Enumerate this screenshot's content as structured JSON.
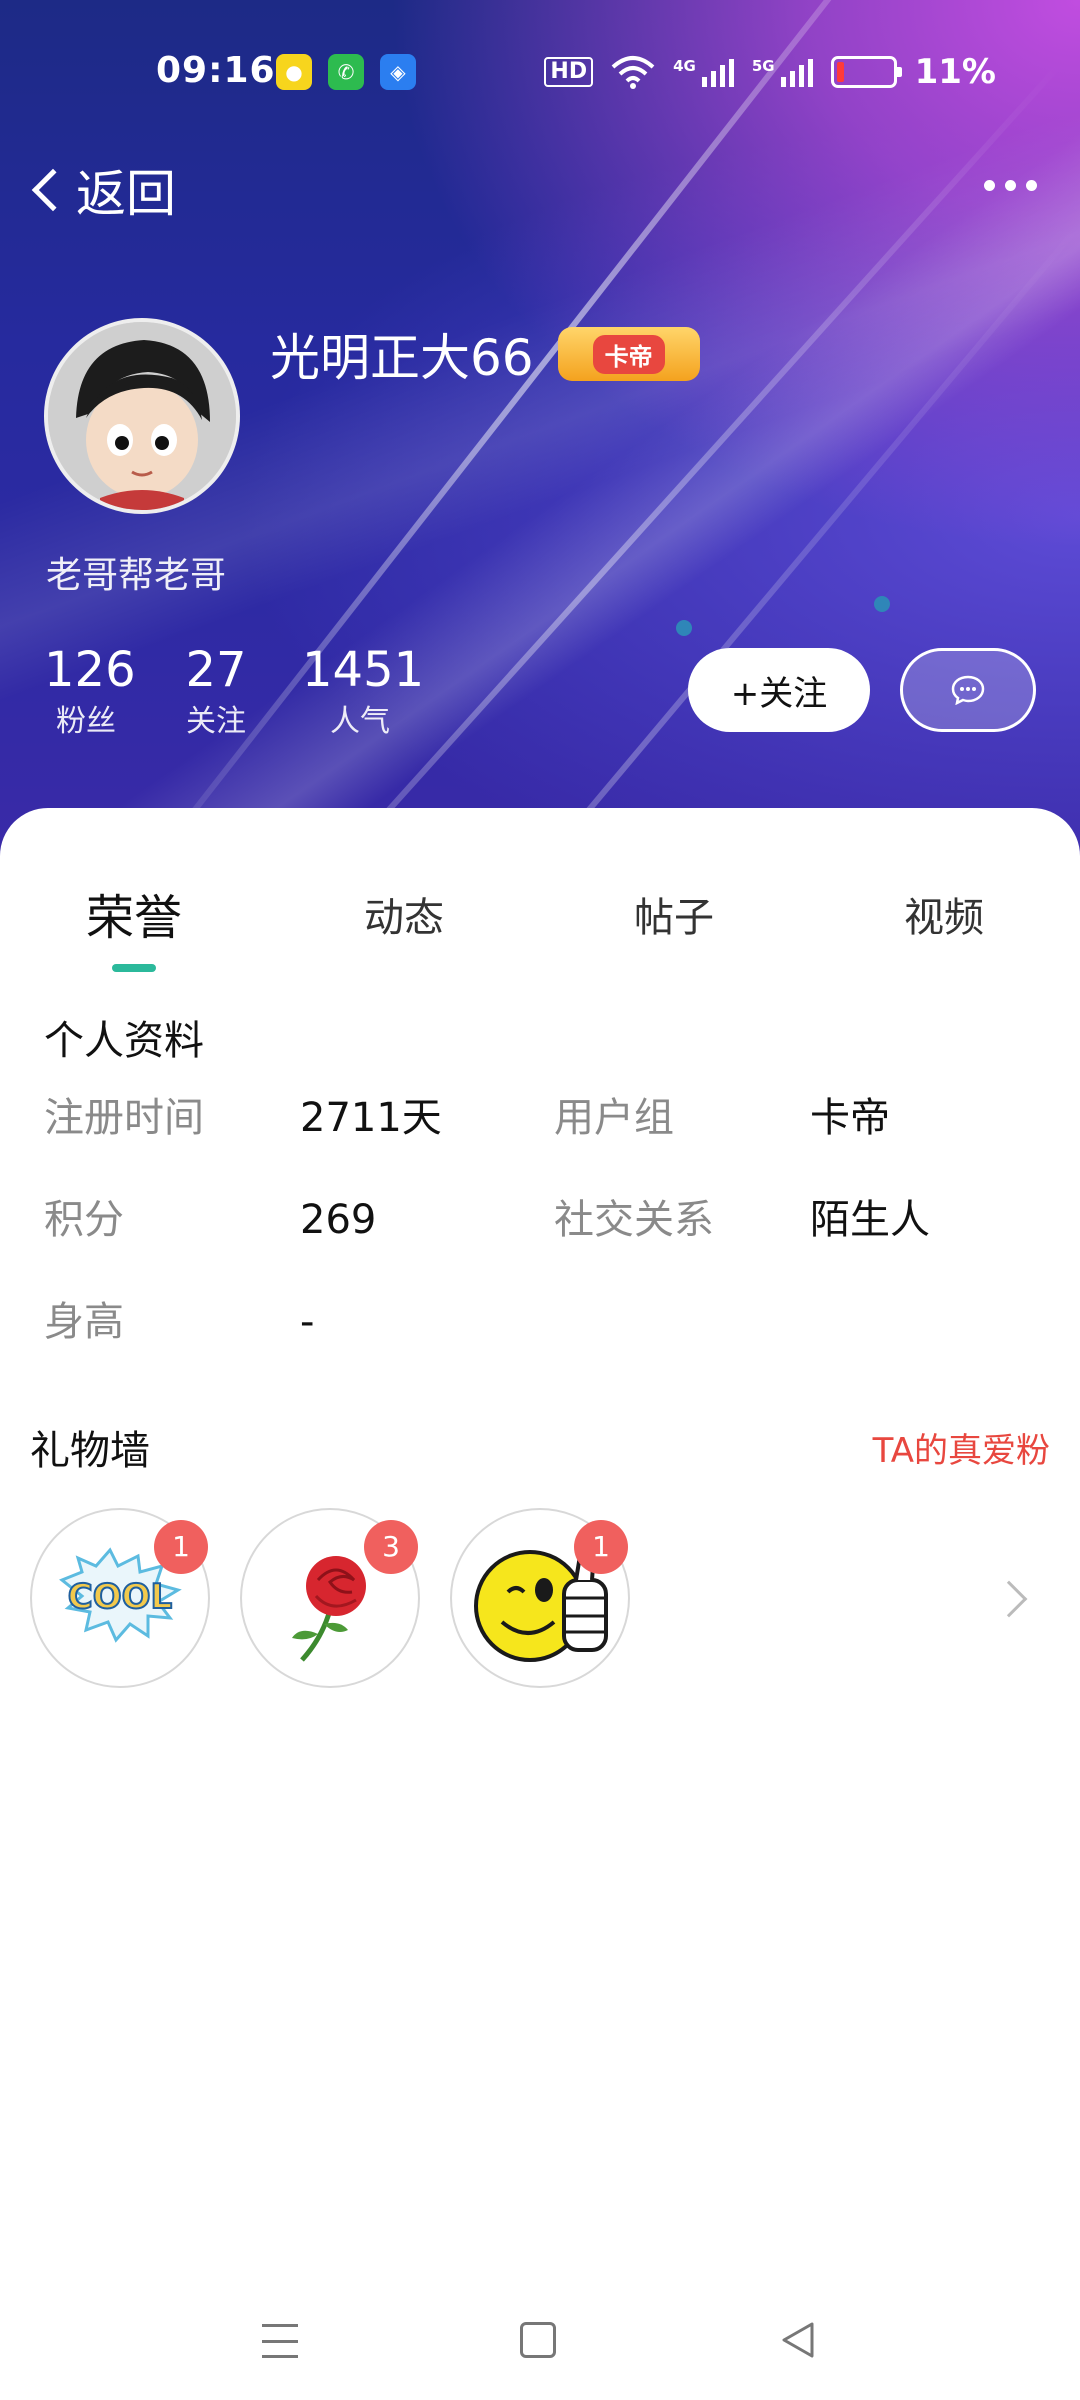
{
  "status_bar": {
    "time": "09:16",
    "hd_label": "HD",
    "net1": "4G",
    "net2": "5G",
    "battery": "11%"
  },
  "nav": {
    "back_label": "返回"
  },
  "profile": {
    "username": "光明正大66",
    "badge": "卡帝",
    "signature": "老哥帮老哥",
    "stats": [
      {
        "value": "126",
        "label": "粉丝"
      },
      {
        "value": "27",
        "label": "关注"
      },
      {
        "value": "1451",
        "label": "人气"
      }
    ],
    "follow_label": "+关注"
  },
  "tabs": [
    "荣誉",
    "动态",
    "帖子",
    "视频"
  ],
  "personal_info": {
    "title": "个人资料",
    "rows": [
      {
        "k1": "注册时间",
        "v1": "2711天",
        "k2": "用户组",
        "v2": "卡帝"
      },
      {
        "k1": "积分",
        "v1": "269",
        "k2": "社交关系",
        "v2": "陌生人"
      },
      {
        "k1": "身高",
        "v1": "-"
      }
    ]
  },
  "gift_wall": {
    "title": "礼物墙",
    "link": "TA的真爱粉",
    "gifts": [
      {
        "name": "cool-sticker",
        "count": "1"
      },
      {
        "name": "rose",
        "count": "3"
      },
      {
        "name": "thumbs-up-wink",
        "count": "1"
      }
    ]
  },
  "colors": {
    "accent_tab": "#2bb99b",
    "link_red": "#e8473f",
    "badge_red": "#f0605e"
  }
}
